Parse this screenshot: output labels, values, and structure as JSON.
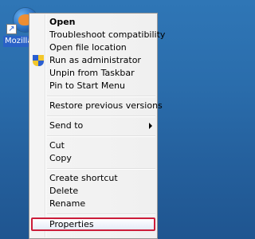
{
  "desktop": {
    "shortcut_label": "Mozilla F",
    "shortcut_arrow_glyph": "↗"
  },
  "context_menu": {
    "items": [
      {
        "type": "item",
        "label": "Open",
        "bold": true
      },
      {
        "type": "item",
        "label": "Troubleshoot compatibility"
      },
      {
        "type": "item",
        "label": "Open file location"
      },
      {
        "type": "item",
        "label": "Run as administrator",
        "icon": "uac-shield-icon"
      },
      {
        "type": "item",
        "label": "Unpin from Taskbar"
      },
      {
        "type": "item",
        "label": "Pin to Start Menu"
      },
      {
        "type": "separator"
      },
      {
        "type": "item",
        "label": "Restore previous versions"
      },
      {
        "type": "separator"
      },
      {
        "type": "item",
        "label": "Send to",
        "submenu": true
      },
      {
        "type": "separator"
      },
      {
        "type": "item",
        "label": "Cut"
      },
      {
        "type": "item",
        "label": "Copy"
      },
      {
        "type": "separator"
      },
      {
        "type": "item",
        "label": "Create shortcut"
      },
      {
        "type": "item",
        "label": "Delete"
      },
      {
        "type": "item",
        "label": "Rename"
      },
      {
        "type": "separator"
      },
      {
        "type": "item",
        "label": "Properties",
        "highlighted": true
      }
    ]
  },
  "colors": {
    "desktop_background": "#2a6dac",
    "selection_label": "#2a62c7",
    "highlight_border": "#cc1d3a",
    "menu_background": "#f0f0f0"
  }
}
